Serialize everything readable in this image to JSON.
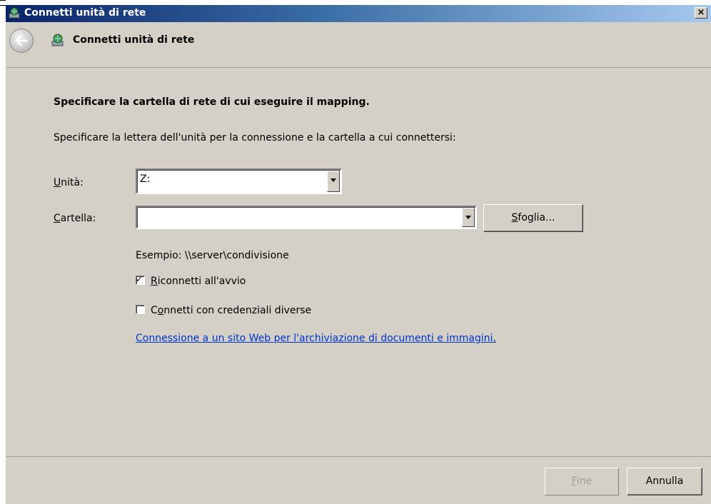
{
  "window": {
    "title": "Connetti unità di rete",
    "close_label": "×"
  },
  "nav": {
    "title": "Connetti unità di rete"
  },
  "form": {
    "heading": "Specificare la cartella di rete di cui eseguire il mapping.",
    "instruction": "Specificare la lettera dell'unità per la connessione e la cartella a cui connettersi:",
    "drive_label_mnemonic": "U",
    "drive_label_rest": "nità:",
    "drive_value": "Z:",
    "folder_label_mnemonic": "C",
    "folder_label_rest": "artella:",
    "folder_value": "",
    "browse_mnemonic": "S",
    "browse_rest": "foglia...",
    "example": "Esempio: \\\\server\\condivisione",
    "reconnect_mnemonic": "R",
    "reconnect_rest": "iconnetti all'avvio",
    "reconnect_checked": true,
    "credentials_pre": "C",
    "credentials_mnemonic": "o",
    "credentials_rest": "nnetti con credenziali diverse",
    "credentials_checked": false,
    "link_text": "Connessione a un sito Web per l'archiviazione di documenti e immagini",
    "link_suffix": "."
  },
  "footer": {
    "finish_mnemonic": "F",
    "finish_rest": "ine",
    "finish_enabled": false,
    "cancel_label": "Annulla"
  },
  "colors": {
    "dialog_bg": "#d4d0c8",
    "title_gradient_start": "#0a246a",
    "title_gradient_end": "#a6caf0",
    "link": "#0033cc",
    "disabled_text": "#a0a0a0"
  },
  "icons": {
    "title_icon": "network-drive-icon",
    "nav_icon": "network-drive-icon",
    "back": "back-arrow-icon",
    "dropdown": "chevron-down-icon",
    "check": "checkmark-icon"
  }
}
